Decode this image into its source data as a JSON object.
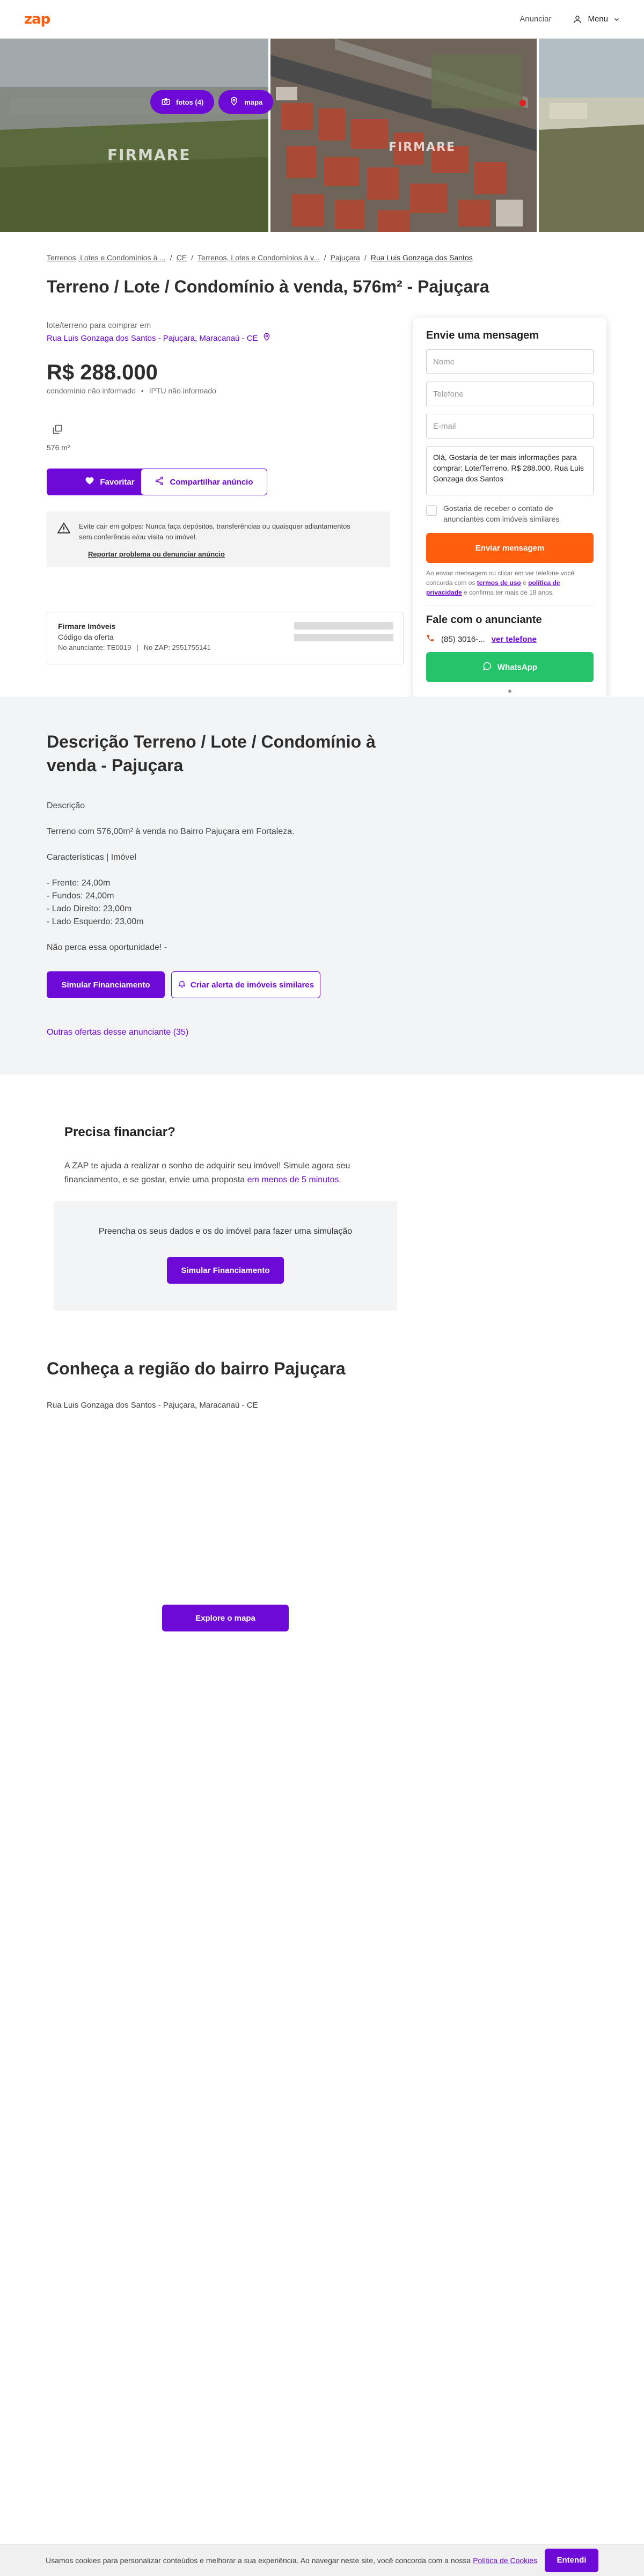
{
  "header": {
    "logo": "zap",
    "announce": "Anunciar",
    "menu": "Menu"
  },
  "gallery": {
    "photos_label": "fotos (4)",
    "map_label": "mapa",
    "watermark": "FIRMARE"
  },
  "breadcrumb": [
    "Terrenos, Lotes e Condomínios à ...",
    "CE",
    "Terrenos, Lotes e Condomínios à v...",
    "Pajuçara",
    "Rua Luis Gonzaga dos Santos"
  ],
  "title": "Terreno / Lote / Condomínio à venda, 576m² - Pajuçara",
  "listing": {
    "subtitle": "lote/terreno para comprar em",
    "address": "Rua Luis Gonzaga dos Santos - Pajuçara, Maracanaú - CE",
    "price": "R$ 288.000",
    "condo": "condomínio não informado",
    "iptu": "IPTU não informado",
    "area": "576 m²",
    "favorite": "Favoritar",
    "share": "Compartilhar anúncio"
  },
  "warning": {
    "text": "Evite cair em golpes: Nunca faça depósitos, transferências ou quaisquer adiantamentos sem conferência e/ou visita no imóvel.",
    "report": "Reportar problema ou denunciar anúncio"
  },
  "advertiser": {
    "name": "Firmare Imóveis",
    "code_label": "Código da oferta",
    "ad_id": "No anunciante: TE0019",
    "zap_id": "No ZAP: 2551755141"
  },
  "contact": {
    "title": "Envie uma mensagem",
    "name_placeholder": "Nome",
    "phone_placeholder": "Telefone",
    "email_placeholder": "E-mail",
    "message": "Olá, Gostaria de ter mais informações para comprar: Lote/Terreno, R$ 288.000, Rua Luis Gonzaga dos Santos",
    "similar_opt": "Gostaria de receber o contato de anunciantes com imóveis similares",
    "send": "Enviar mensagem",
    "legal_1": "Ao enviar mensagem ou clicar em ver telefone você concorda com os",
    "terms": "termos de uso",
    "legal_2": "e",
    "privacy": "política de privacidade",
    "legal_3": "e confirma ter mais de 18 anos.",
    "talk_title": "Fale com o anunciante",
    "phone_partial": "(85) 3016-...",
    "see_phone": "ver telefone",
    "whatsapp": "WhatsApp"
  },
  "description": {
    "title": "Descrição Terreno / Lote / Condomínio à venda - Pajuçara",
    "lines": [
      "Descrição",
      "Terreno com 576,00m² à venda no Bairro Pajuçara em Fortaleza.",
      "Características | Imóvel",
      "- Frente: 24,00m",
      "- Fundos: 24,00m",
      "- Lado Direito: 23,00m",
      "- Lado Esquerdo: 23,00m",
      "Não perca essa oportunidade! -"
    ],
    "simulate": "Simular Financiamento",
    "alert": "Criar alerta de imóveis similares",
    "other_offers": "Outras ofertas desse anunciante (35)"
  },
  "finance": {
    "title": "Precisa financiar?",
    "text": "A ZAP te ajuda a realizar o sonho de adquirir seu imóvel! Simule agora seu financiamento, e se gostar, envie uma proposta",
    "highlight": "em menos de 5 minutos.",
    "box_text": "Preencha os seus dados e os do imóvel para fazer uma simulação",
    "button": "Simular Financiamento"
  },
  "region": {
    "title": "Conheça a região do bairro Pajuçara",
    "address": "Rua Luis Gonzaga dos Santos - Pajuçara, Maracanaú - CE",
    "explore": "Explore o mapa"
  },
  "cookie": {
    "text": "Usamos cookies para personalizar conteúdos e melhorar a sua experiência. Ao navegar neste site, você concorda com a nossa",
    "policy": "Política de Cookies",
    "accept": "Entendi"
  },
  "colors": {
    "brand_orange": "#ff5e0e",
    "brand_purple": "#6d0ad6",
    "whatsapp_green": "#25c46b"
  }
}
